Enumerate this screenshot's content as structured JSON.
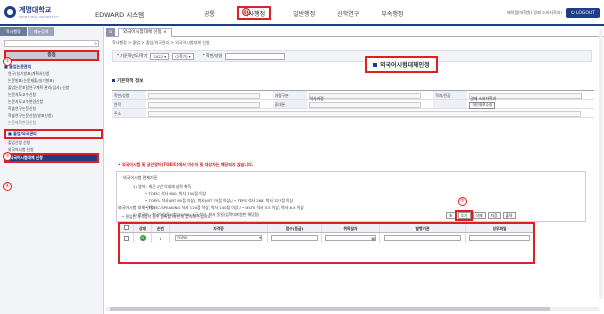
{
  "header": {
    "logo_title": "계명대학교",
    "logo_sub": "KEIMYUNG UNIVERSITY",
    "system_title": "EDWARD 시스템",
    "menu": [
      "공통",
      "학사행정",
      "일반행정",
      "산학연구",
      "부속행정"
    ],
    "active_menu_index": 1,
    "marker_1": "①",
    "user_name": "매직캠(마학원) 경제 소비자학과)",
    "logout_label": "LOGOUT"
  },
  "sidebar": {
    "tabs": [
      "학사행정",
      "메뉴검색"
    ],
    "search_placeholder": "",
    "header": "중점",
    "marker_2": "②",
    "group1": "졸업논문관리",
    "group1_items": [
      "연구(실기발표)계획서신청",
      "논문발표(논문제출/실기발표)",
      "졸업논문포함연구계획 관리(심사) 신청",
      "논문지도교수신청",
      "논문지도교수변경신청",
      "학술연구논문신청",
      "학술연구논문신청(발표신청)",
      "논문제목변경신청"
    ],
    "marker_3": "③",
    "group2": "졸업/외국관리",
    "group2_items": [
      "졸업신청 신청",
      "외국어시험 신청"
    ],
    "marker_4": "④",
    "selected_item": "외국어시험대체 신청"
  },
  "main": {
    "home_label": "⌂",
    "tab_label": "외국어시험대체 신청 ×",
    "breadcrumb": "학사행정 > 졸업 > 졸업/외국관리 > 외국어시험대체 신청",
    "filter": {
      "year_label": "* 기준학년도/학기",
      "year": "2022",
      "term": "(2학기)",
      "student_label": "* 학번/성명",
      "student_value": ""
    },
    "page_title": "외국어시험대체인정",
    "section_student": "기본학적 정보",
    "info": {
      "row1": [
        "학번/성명",
        "",
        "과정구분",
        "석사과정",
        "학과/전공",
        "경제 소비자학과"
      ],
      "row2": [
        "연락",
        "",
        "휴대폰",
        "",
        "",
        "개인정보수정"
      ],
      "row3": [
        "주소",
        ""
      ]
    },
    "notice": "• 외국어시험 및 공인영어(TOEIC)에서 이수자 및 대상자는 해당되지 않습니다.",
    "req_head": "외국어시험 면제기준",
    "req_lines": [
      "1) 영어 : 최근 2년 이내에 성적 취득",
      "• TOEIC 석사 600, 박사 700점 이상",
      "• TOEFL 석사(IBT 65점 이상), 박사(IBT 75점 이상)/ • TEPS 석사 268, 박사 327점 이상",
      "• TOEIC-SPEAKING 석사 120점 이상, 박사 140점 이상 / • IELTS 석사 5.5 이상, 박사 6.5 이상",
      "2) 한국어 : 한국어능력시험(TOPIK) 4급 석사, 박사 동일(입학대비원한 해당함)"
    ],
    "apply_title": "외국어시험 대체 인정",
    "apply_note": "• 필입한 자격증이 경우 등록할 때 한해 입력해 주십시오.",
    "marker_5": "⑤",
    "buttons": [
      "초",
      "추가",
      "삭제",
      "저장",
      "출력"
    ],
    "grid": {
      "headers": [
        "",
        "상태",
        "순번",
        "자격증",
        "점수(등급)",
        "취득일자",
        "발행기관",
        "성무파일"
      ],
      "rows": [
        {
          "status": "N",
          "seq": "1",
          "cert": "TOPIK",
          "score": "",
          "date": "",
          "issuer": "",
          "file": ""
        }
      ]
    }
  }
}
